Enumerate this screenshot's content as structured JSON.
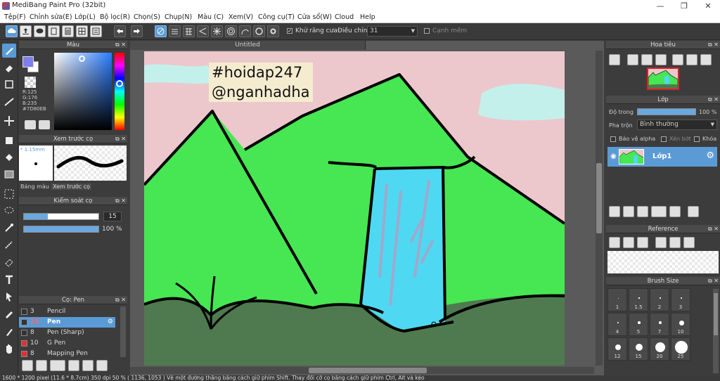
{
  "window": {
    "title": "MediBang Paint Pro (32bit)",
    "minimize_icon": "minimize-icon",
    "maximize_icon": "restore-icon",
    "close_icon": "close-icon"
  },
  "menu": [
    "Tệp(F)",
    "Chỉnh sửa(E)",
    "Lớp(L)",
    "Bộ lọc(R)",
    "Chọn(S)",
    "Chụp(N)",
    "Màu (C)",
    "Xem(V)",
    "Công cụ(T)",
    "Cửa sổ(W)",
    "Cloud",
    "Help"
  ],
  "toolbar": {
    "antialias_label": "Khử răng cưa",
    "antialias_checked": true,
    "adjust_label": "Điều chỉnh",
    "adjust_value": "31",
    "smooth_label": "Cạnh mềm",
    "smooth_checked": false
  },
  "color_panel": {
    "title": "Màu",
    "primary_color": "#7D80EB",
    "r_label": "R:125",
    "g_label": "G:176",
    "b_label": "B:235",
    "hex_label": "#7D80EB"
  },
  "preview_panel": {
    "title": "Xem trước cọ",
    "size": "* 1.15mm",
    "tab_color_bar": "Bảng màu",
    "tab_preview": "Xem trước cọ"
  },
  "brush_control": {
    "title": "Kiểm soát cọ",
    "size_value": "15",
    "opacity_value": "100 %",
    "size_fraction": 0.32,
    "opacity_fraction": 1.0
  },
  "brush_panel": {
    "title": "Cọ: Pen",
    "items": [
      {
        "size": "3",
        "name": "Pencil",
        "color": "#333333"
      },
      {
        "size": "15",
        "name": "Pen",
        "color": "#333333",
        "selected": true
      },
      {
        "size": "8",
        "name": "Pen (Sharp)",
        "color": "#333333"
      },
      {
        "size": "10",
        "name": "G Pen",
        "color": "#e03030"
      },
      {
        "size": "8",
        "name": "Mapping Pen",
        "color": "#e03030"
      }
    ]
  },
  "document": {
    "tab_title": "Untitled",
    "watermark_line1": "#hoidap247",
    "watermark_line2": "@nganhadha"
  },
  "navigator": {
    "title": "Hoa tiêu"
  },
  "layer_panel": {
    "title": "Lớp",
    "opacity_label": "Độ trong",
    "opacity_value": "100 %",
    "opacity_fraction": 1.0,
    "blend_label": "Pha trộn",
    "blend_value": "Bình thường",
    "protect_alpha": "Bảo vệ alpha",
    "clipping": "Xén bớt",
    "lock": "Khóa",
    "layer_name": "Lớp1"
  },
  "reference_panel": {
    "title": "Reference"
  },
  "brush_size_panel": {
    "title": "Brush Size",
    "sizes": [
      "1",
      "1.5",
      "2",
      "3",
      "4",
      "5",
      "7",
      "10",
      "12",
      "15",
      "20",
      "25"
    ]
  },
  "status": {
    "text": "1600 * 1200 pixel   (11.6 * 8.7cm)   350 dpi   50 %   ( 1136, 1053 )   Vẽ một đường thẳng bằng cách giữ phím Shift. Thay đổi cỡ cọ bằng cách giữ phím Ctrl, Alt và kéo"
  },
  "colors": {
    "sky": "#ecc8cc",
    "cloud": "#c4f0ec",
    "mountain": "#47e653",
    "ground": "#4f7a4f",
    "water": "#4fd8f2",
    "accent": "#5b9bd5"
  }
}
